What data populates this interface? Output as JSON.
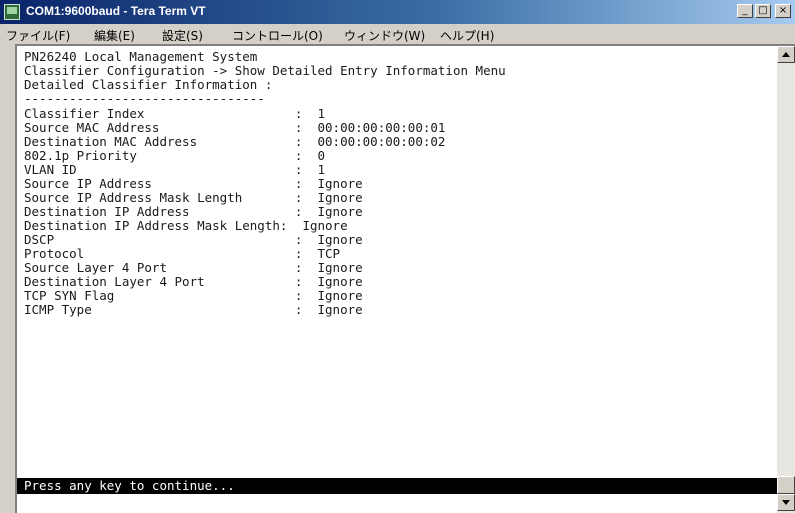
{
  "window": {
    "title": "COM1:9600baud - Tera Term VT",
    "controls": {
      "minimize": "_",
      "maximize": "□",
      "close": "×"
    }
  },
  "menu": {
    "items": [
      "ファイル(F)",
      "編集(E)",
      "設定(S)",
      "コントロール(O)",
      "ウィンドウ(W)",
      "ヘルプ(H)"
    ]
  },
  "terminal": {
    "lines": [
      "PN26240 Local Management System",
      "Classifier Configuration -> Show Detailed Entry Information Menu",
      "Detailed Classifier Information :",
      "--------------------------------",
      "Classifier Index                    :  1",
      "Source MAC Address                  :  00:00:00:00:00:01",
      "Destination MAC Address             :  00:00:00:00:00:02",
      "802.1p Priority                     :  0",
      "VLAN ID                             :  1",
      "Source IP Address                   :  Ignore",
      "Source IP Address Mask Length       :  Ignore",
      "Destination IP Address              :  Ignore",
      "Destination IP Address Mask Length:  Ignore",
      "DSCP                                :  Ignore",
      "Protocol                            :  TCP",
      "Source Layer 4 Port                 :  Ignore",
      "Destination Layer 4 Port            :  Ignore",
      "TCP SYN Flag                        :  Ignore",
      "ICMP Type                           :  Ignore"
    ],
    "status_prompt": "Press any key to continue..."
  }
}
